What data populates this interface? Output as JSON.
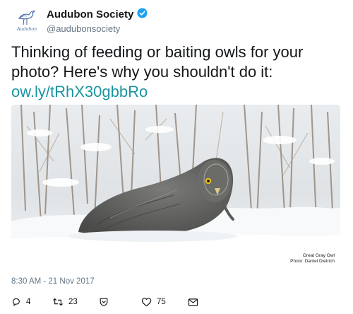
{
  "account": {
    "display_name": "Audubon Society",
    "handle": "@audubonsociety",
    "avatar_wordmark": "Audubon"
  },
  "tweet": {
    "text": "Thinking of feeding or baiting owls for your photo? Here's why you shouldn't do it:",
    "link": "ow.ly/tRhX30gbbRo",
    "timestamp": "8:30 AM - 21 Nov 2017"
  },
  "photo": {
    "credit_title": "Great Gray Owl",
    "credit_photographer": "Photo: Daniel Dietrich"
  },
  "actions": {
    "reply_count": "4",
    "retweet_count": "23",
    "like_count": "75"
  },
  "colors": {
    "link": "#1b95a0",
    "verified": "#1da1f2",
    "muted": "#657786"
  },
  "icons": [
    "audubon-egret-logo-icon",
    "verified-badge-icon",
    "reply-icon",
    "retweet-icon",
    "save-icon",
    "like-icon",
    "message-icon"
  ]
}
